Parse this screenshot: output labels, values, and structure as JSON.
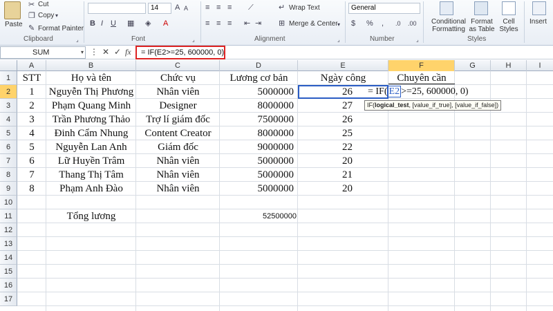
{
  "ribbon": {
    "clipboard": {
      "paste": "Paste",
      "cut": "Cut",
      "copy": "Copy",
      "format_painter": "Format Painter",
      "group": "Clipboard"
    },
    "font": {
      "size": "14",
      "group": "Font"
    },
    "alignment": {
      "wrap_text": "Wrap Text",
      "merge_center": "Merge & Center",
      "group": "Alignment"
    },
    "number": {
      "format": "General",
      "group": "Number"
    },
    "styles": {
      "conditional_formatting": "Conditional Formatting",
      "format_as_table": "Format as Table",
      "cell_styles": "Cell Styles",
      "group": "Styles"
    },
    "cells": {
      "insert": "Insert"
    }
  },
  "formula_bar": {
    "name_box": "SUM",
    "fx": "fx",
    "formula": "= IF(E2>=25, 600000, 0)"
  },
  "columns": [
    "A",
    "B",
    "C",
    "D",
    "E",
    "F",
    "G",
    "H",
    "I"
  ],
  "rows": [
    "1",
    "2",
    "3",
    "4",
    "5",
    "6",
    "7",
    "8",
    "9",
    "10",
    "11",
    "12",
    "13",
    "14",
    "15",
    "16",
    "17"
  ],
  "table": {
    "headers": [
      "STT",
      "Họ và tên",
      "Chức vụ",
      "Lương cơ bản",
      "Ngày công",
      "Chuyên cần"
    ],
    "data": [
      [
        "1",
        "Nguyễn Thị Phương",
        "Nhân viên",
        "5000000",
        "26"
      ],
      [
        "2",
        "Phạm Quang Minh",
        "Designer",
        "8000000",
        "27"
      ],
      [
        "3",
        "Trần Phương Thảo",
        "Trợ lí giám đốc",
        "7500000",
        "26"
      ],
      [
        "4",
        "Đinh Cẩm Nhung",
        "Content Creator",
        "8000000",
        "25"
      ],
      [
        "5",
        "Nguyễn Lan Anh",
        "Giám đốc",
        "9000000",
        "22"
      ],
      [
        "6",
        "Lữ Huyền Trâm",
        "Nhân viên",
        "5000000",
        "20"
      ],
      [
        "7",
        "Thang Thị Tâm",
        "Nhân viên",
        "5000000",
        "21"
      ],
      [
        "8",
        "Phạm Anh Đào",
        "Nhân viên",
        "5000000",
        "20"
      ]
    ],
    "total_label": "Tổng lương",
    "total_value": "52500000"
  },
  "editing": {
    "prefix": "= IF(",
    "ref": "E2",
    "suffix": ">=25, 600000, 0)",
    "tooltip_fn": "IF(",
    "tooltip_arg1": "logical_test",
    "tooltip_rest": ", [value_if_true], [value_if_false])"
  }
}
